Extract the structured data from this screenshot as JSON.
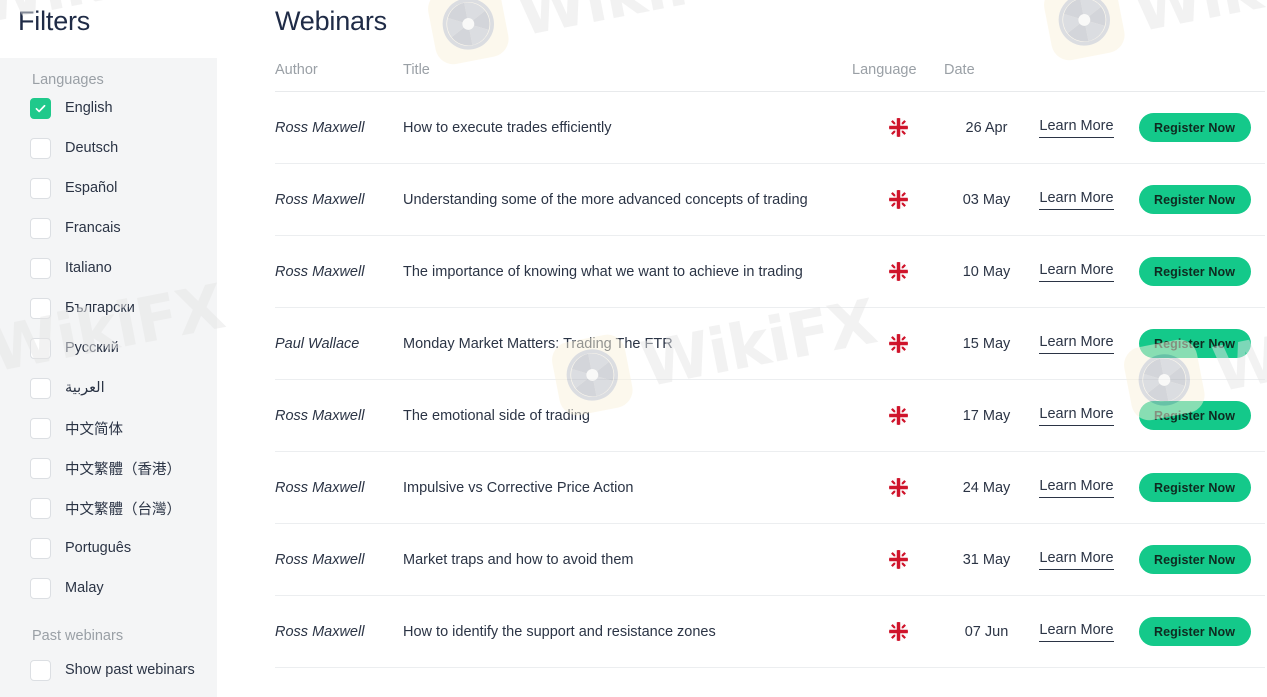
{
  "sidebar": {
    "heading": "Filters",
    "languages_label": "Languages",
    "languages": [
      {
        "label": "English",
        "checked": true
      },
      {
        "label": "Deutsch",
        "checked": false
      },
      {
        "label": "Español",
        "checked": false
      },
      {
        "label": "Francais",
        "checked": false
      },
      {
        "label": "Italiano",
        "checked": false
      },
      {
        "label": "Български",
        "checked": false
      },
      {
        "label": "Русский",
        "checked": false
      },
      {
        "label": "العربية",
        "checked": false
      },
      {
        "label": "中文简体",
        "checked": false
      },
      {
        "label": "中文繁體（香港）",
        "checked": false
      },
      {
        "label": "中文繁體（台灣）",
        "checked": false
      },
      {
        "label": "Português",
        "checked": false
      },
      {
        "label": "Malay",
        "checked": false
      }
    ],
    "past_label": "Past webinars",
    "past_options": [
      {
        "label": "Show past webinars",
        "checked": false
      }
    ]
  },
  "main": {
    "title": "Webinars",
    "columns": {
      "author": "Author",
      "title": "Title",
      "language": "Language",
      "date": "Date"
    },
    "learn_more_label": "Learn More",
    "register_label": "Register Now",
    "flag_icon": "uk-flag-icon",
    "rows": [
      {
        "author": "Ross Maxwell",
        "title": "How to execute trades efficiently",
        "language": "English",
        "date": "26 Apr"
      },
      {
        "author": "Ross Maxwell",
        "title": "Understanding some of the more advanced concepts of trading",
        "language": "English",
        "date": "03 May"
      },
      {
        "author": "Ross Maxwell",
        "title": "The importance of knowing what we want to achieve in trading",
        "language": "English",
        "date": "10 May"
      },
      {
        "author": "Paul Wallace",
        "title": "Monday Market Matters: Trading The FTR",
        "language": "English",
        "date": "15 May"
      },
      {
        "author": "Ross Maxwell",
        "title": "The emotional side of trading",
        "language": "English",
        "date": "17 May"
      },
      {
        "author": "Ross Maxwell",
        "title": "Impulsive vs Corrective Price Action",
        "language": "English",
        "date": "24 May"
      },
      {
        "author": "Ross Maxwell",
        "title": "Market traps and how to avoid them",
        "language": "English",
        "date": "31 May"
      },
      {
        "author": "Ross Maxwell",
        "title": "How to identify the support and resistance zones",
        "language": "English",
        "date": "07 Jun"
      }
    ]
  },
  "watermark": {
    "text": "WikiFX",
    "logo_icon": "wikifx-aperture-logo-icon"
  },
  "colors": {
    "accent_green": "#14c98a",
    "checkbox_checked": "#1fc98b",
    "text_primary": "#2b3445",
    "text_muted": "#9aa0a6",
    "panel_bg": "#f4f5f6",
    "watermark_text": "#e6e6e6",
    "watermark_logo_bg": "#fbf3dd"
  }
}
